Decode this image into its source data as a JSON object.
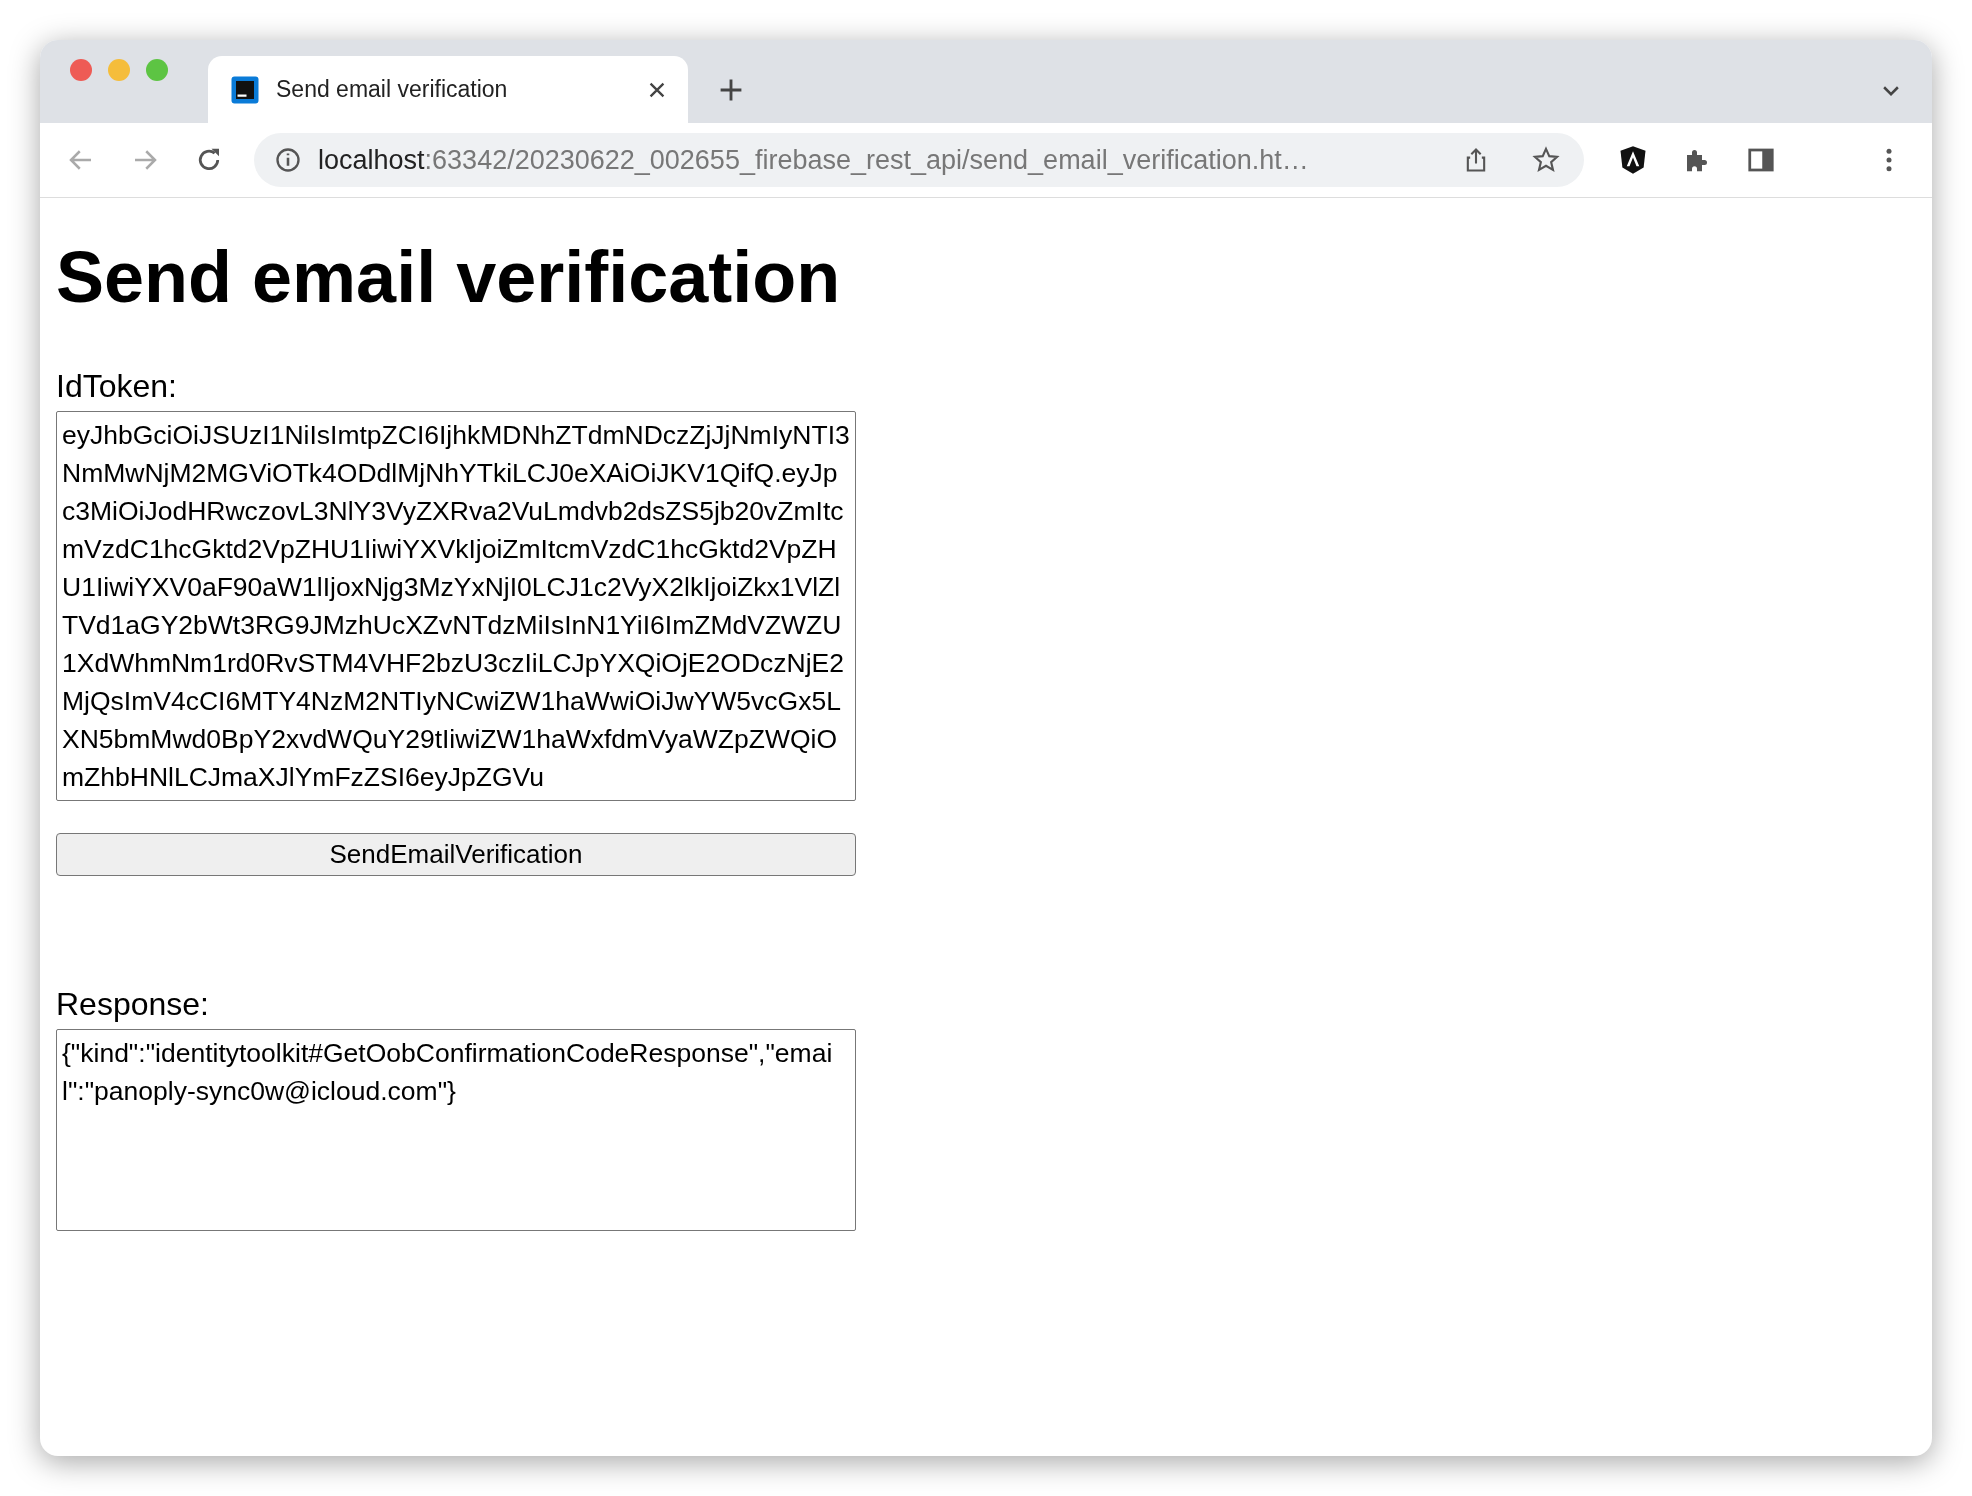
{
  "tab": {
    "title": "Send email verification",
    "selected": true
  },
  "address_bar": {
    "host": "localhost",
    "path": ":63342/20230622_002655_firebase_rest_api/send_email_verification.ht…"
  },
  "page": {
    "heading": "Send email verification",
    "id_token": {
      "label": "IdToken:",
      "value": "eyJhbGciOiJSUzI1NiIsImtpZCI6IjhkMDNhZTdmNDczZjJjNmIyNTI3NmMwNjM2MGViOTk4ODdlMjNhYTkiLCJ0eXAiOiJKV1QifQ.eyJpc3MiOiJodHRwczovL3NlY3VyZXRva2VuLmdvb2dsZS5jb20vZmItcmVzdC1hcGktd2VpZHU1IiwiYXVkIjoiZmItcmVzdC1hcGktd2VpZHU1IiwiYXV0aF90aW1lIjoxNjg3MzYxNjI0LCJ1c2VyX2lkIjoiZkx1VlZlTVd1aGY2bWt3RG9JMzhUcXZvNTdzMiIsInN1YiI6ImZMdVZWZU1XdWhmNm1rd0RvSTM4VHF2bzU3czIiLCJpYXQiOjE2ODczNjE2MjQsImV4cCI6MTY4NzM2NTIyNCwiZW1haWwiOiJwYW5vcGx5LXN5bmMwd0BpY2xvdWQuY29tIiwiZW1haWxfdmVyaWZpZWQiOmZhbHNlLCJmaXJlYmFzZSI6eyJpZGVu"
    },
    "button": "SendEmailVerification",
    "response": {
      "label": "Response:",
      "value": "{\"kind\":\"identitytoolkit#GetOobConfirmationCodeResponse\",\"email\":\"panoply-sync0w@icloud.com\"}"
    }
  }
}
